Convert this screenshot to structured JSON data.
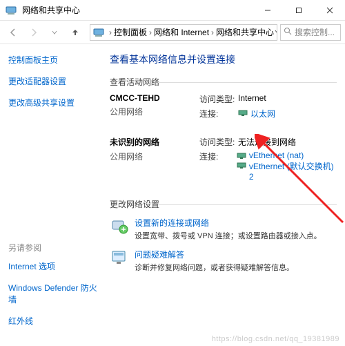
{
  "window": {
    "title": "网络和共享中心"
  },
  "breadcrumb": {
    "items": [
      "控制面板",
      "网络和 Internet",
      "网络和共享中心"
    ]
  },
  "search": {
    "placeholder": "搜索控制..."
  },
  "sidebar": {
    "items": [
      {
        "label": "控制面板主页"
      },
      {
        "label": "更改适配器设置"
      },
      {
        "label": "更改高级共享设置"
      }
    ],
    "seealso_label": "另请参阅",
    "seealso": [
      {
        "label": "Internet 选项"
      },
      {
        "label": "Windows Defender 防火墙"
      },
      {
        "label": "红外线"
      }
    ]
  },
  "main": {
    "heading": "查看基本网络信息并设置连接",
    "active_label": "查看活动网络",
    "networks": [
      {
        "name": "CMCC-TEHD",
        "type": "公用网络",
        "access_label": "访问类型:",
        "access_value": "Internet",
        "conn_label": "连接:",
        "connections": [
          "以太网"
        ]
      },
      {
        "name": "未识别的网络",
        "type": "公用网络",
        "access_label": "访问类型:",
        "access_value": "无法连接到网络",
        "conn_label": "连接:",
        "connections": [
          "vEthernet (nat)",
          "vEthernet (默认交换机) 2"
        ]
      }
    ],
    "change_label": "更改网络设置",
    "change_items": [
      {
        "title": "设置新的连接或网络",
        "desc": "设置宽带、拨号或 VPN 连接；或设置路由器或接入点。"
      },
      {
        "title": "问题疑难解答",
        "desc": "诊断并修复网络问题，或者获得疑难解答信息。"
      }
    ]
  },
  "watermark": "https://blog.csdn.net/qq_19381989"
}
